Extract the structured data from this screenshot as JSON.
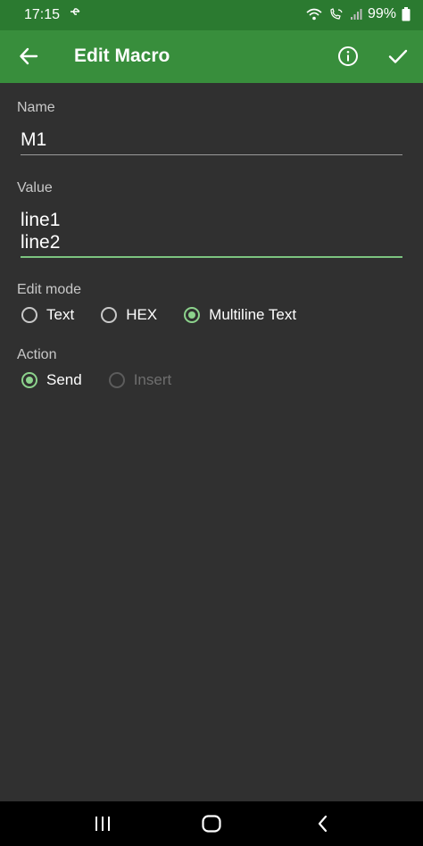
{
  "status_bar": {
    "time": "17:15",
    "battery": "99%",
    "icons": [
      "usb-icon",
      "wifi-icon",
      "wifi-call-icon",
      "signal-icon",
      "battery-icon"
    ]
  },
  "app_bar": {
    "title": "Edit Macro",
    "back_icon": "arrow-back-icon",
    "info_icon": "info-icon",
    "confirm_icon": "check-icon"
  },
  "form": {
    "name": {
      "label": "Name",
      "value": "M1"
    },
    "value": {
      "label": "Value",
      "lines": [
        "line1",
        "line2"
      ]
    },
    "edit_mode": {
      "label": "Edit mode",
      "options": [
        "Text",
        "HEX",
        "Multiline Text"
      ],
      "selected": "Multiline Text"
    },
    "action": {
      "label": "Action",
      "options": [
        "Send",
        "Insert"
      ],
      "selected": "Send",
      "disabled": [
        "Insert"
      ]
    }
  },
  "nav_bar": {
    "icons": [
      "recent-apps-icon",
      "home-icon",
      "back-nav-icon"
    ]
  },
  "colors": {
    "status_bar": "#2b7a30",
    "app_bar": "#388e3c",
    "background": "#303030",
    "accent": "#8cd28c",
    "focused_underline": "#7cc47f"
  }
}
